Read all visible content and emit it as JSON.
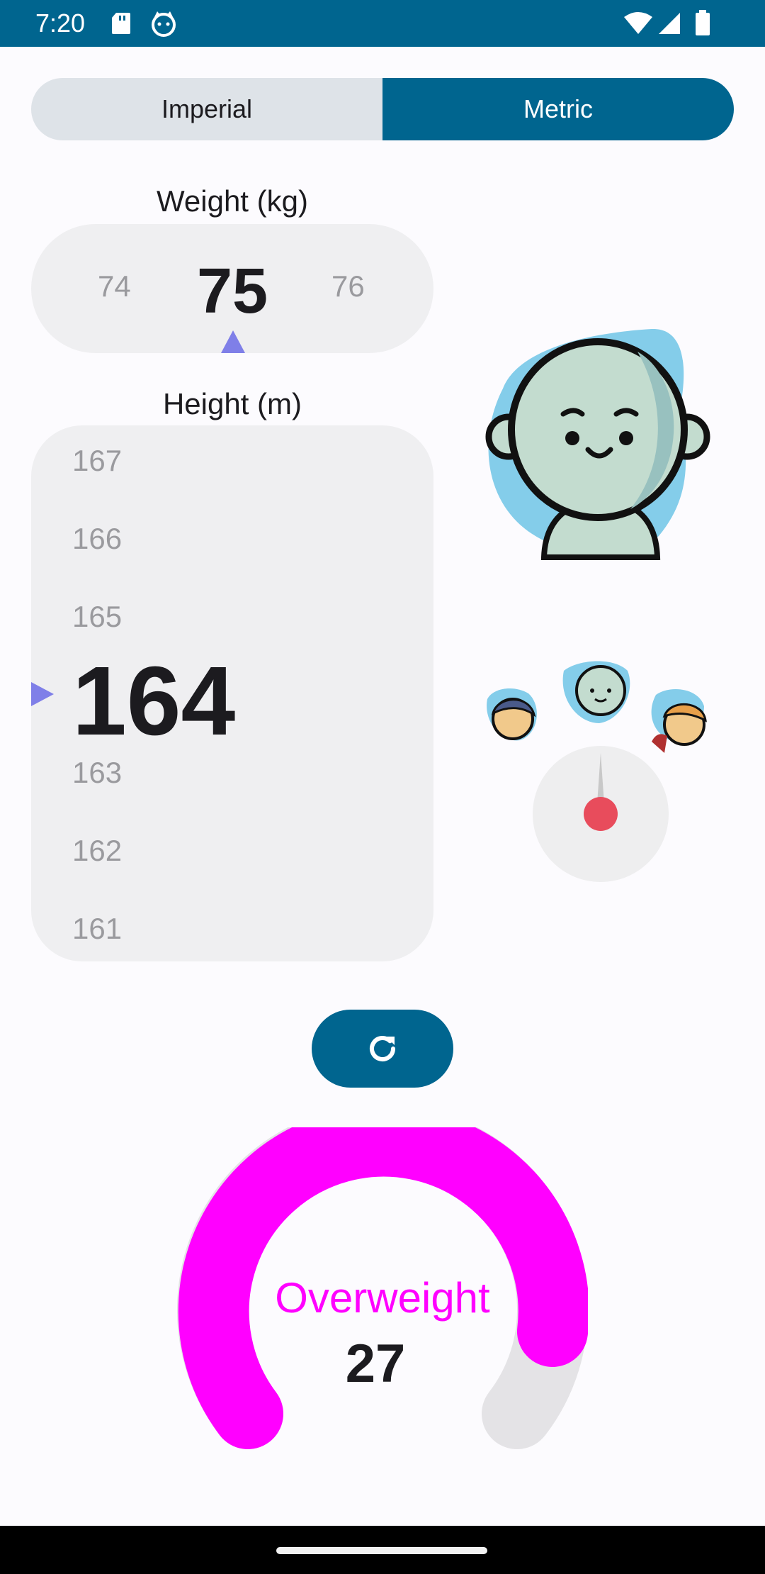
{
  "status_bar": {
    "time": "7:20",
    "icons": [
      "sd-card-icon",
      "cat-icon",
      "wifi-icon",
      "signal-icon",
      "battery-icon"
    ]
  },
  "unit_toggle": {
    "options": [
      "Imperial",
      "Metric"
    ],
    "selected": "Metric"
  },
  "weight": {
    "label": "Weight (kg)",
    "prev": "74",
    "current": "75",
    "next": "76"
  },
  "height": {
    "label": "Height (m)",
    "above": [
      "167",
      "166",
      "165"
    ],
    "current": "164",
    "below": [
      "163",
      "162",
      "161"
    ]
  },
  "refresh": {
    "icon": "refresh-icon"
  },
  "result": {
    "category": "Overweight",
    "bmi": "27",
    "gauge_fill_fraction": 0.9
  },
  "colors": {
    "primary": "#00658f",
    "gauge_active": "#ff00ff",
    "gauge_track": "#e4e3e6",
    "marker": "#7f7fe8",
    "needle_dot": "#e84c5c"
  }
}
